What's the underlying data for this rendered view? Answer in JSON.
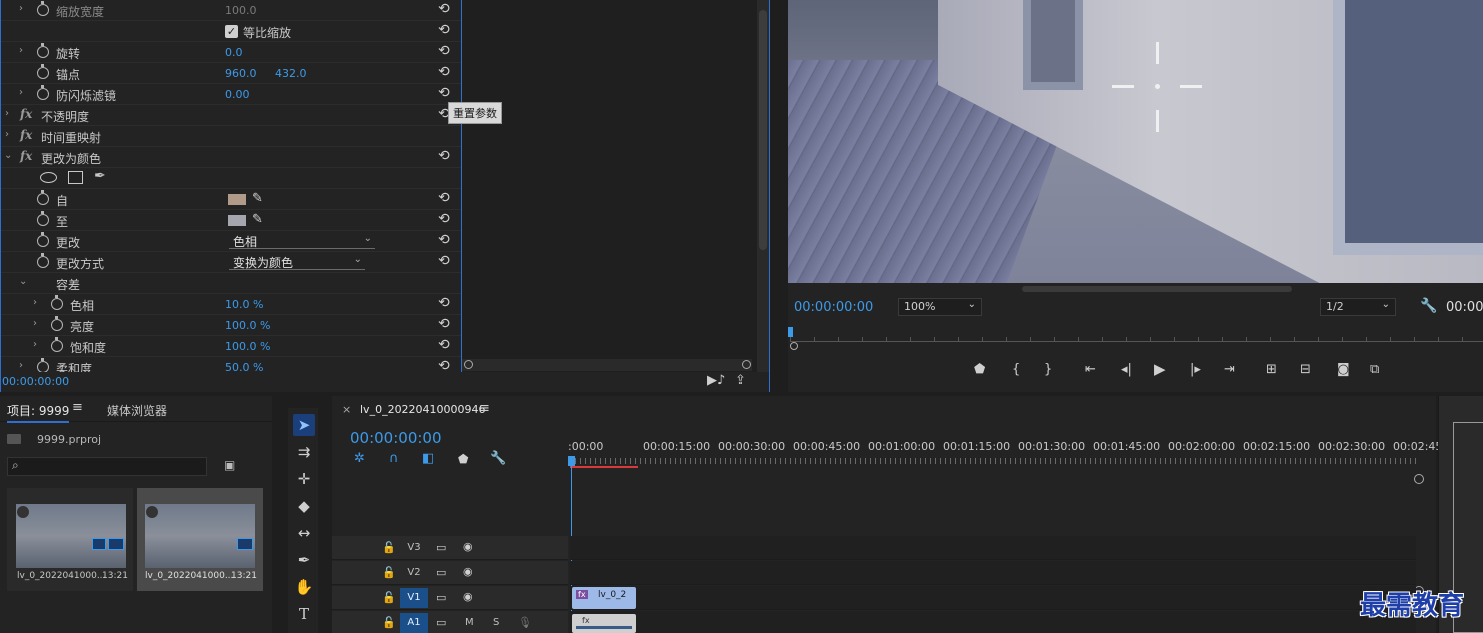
{
  "effects": {
    "rows": [
      {
        "label": "缩放宽度",
        "value": "100.0",
        "dim": true
      },
      {
        "label": "等比缩放",
        "checked": true
      },
      {
        "label": "旋转",
        "value": "0.0"
      },
      {
        "label": "锚点",
        "value": "960.0",
        "value2": "432.0"
      },
      {
        "label": "防闪烁滤镜",
        "value": "0.00"
      },
      {
        "label": "不透明度"
      },
      {
        "label": "时间重映射"
      },
      {
        "label": "更改为颜色"
      },
      {
        "label": "自",
        "color": "#b09a8a"
      },
      {
        "label": "至",
        "color": "#a5a5ad"
      },
      {
        "label": "更改",
        "select": "色相"
      },
      {
        "label": "更改方式",
        "select": "变换为颜色"
      },
      {
        "label": "容差"
      },
      {
        "label": "色相",
        "value": "10.0",
        "unit": "%"
      },
      {
        "label": "亮度",
        "value": "100.0",
        "unit": "%"
      },
      {
        "label": "饱和度",
        "value": "100.0",
        "unit": "%"
      },
      {
        "label": "柔和度",
        "value": "50.0",
        "unit": "%"
      }
    ],
    "tooltip": "重置参数",
    "timecode": "00:00:00:00"
  },
  "monitor": {
    "timecode": "00:00:00:00",
    "zoom": "100%",
    "resolution": "1/2",
    "timecode_right": "00:00"
  },
  "project": {
    "tab_project": "项目: 9999",
    "tab_media": "媒体浏览器",
    "file": "9999.prproj",
    "items": [
      {
        "name": "lv_0_2022041000...",
        "duration": "13:21"
      },
      {
        "name": "lv_0_2022041000...",
        "duration": "13:21"
      }
    ]
  },
  "timeline": {
    "sequence_name": "lv_0_20220410000946",
    "timecode": "00:00:00:00",
    "ruler": [
      ":00:00",
      "00:00:15:00",
      "00:00:30:00",
      "00:00:45:00",
      "00:01:00:00",
      "00:01:15:00",
      "00:01:30:00",
      "00:01:45:00",
      "00:02:00:00",
      "00:02:15:00",
      "00:02:30:00",
      "00:02:45:0"
    ],
    "tracks": [
      "V3",
      "V2",
      "V1",
      "A1"
    ],
    "track_m": "M",
    "track_s": "S",
    "clip_name": "lv_0_2",
    "fx_badge": "fx"
  },
  "watermark": "最需教育",
  "colors": {
    "accent": "#3d9ae8",
    "panel_border": "#2f6fd1"
  }
}
